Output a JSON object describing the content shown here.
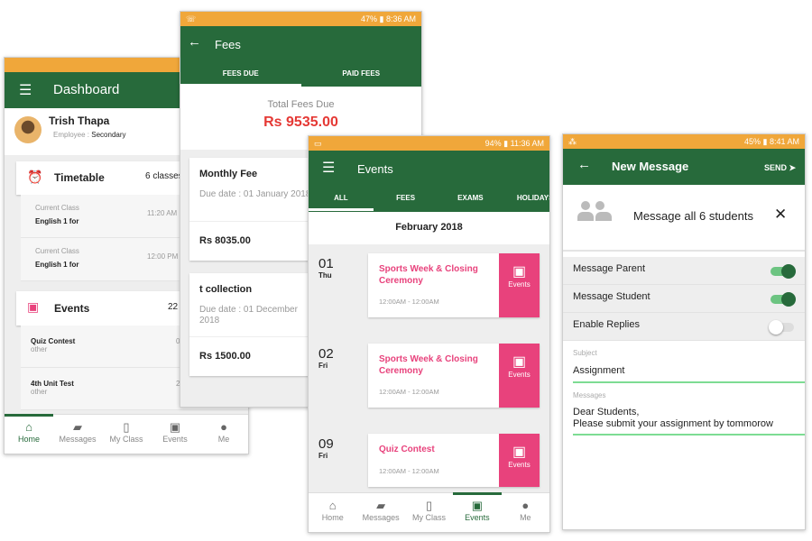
{
  "dashboard": {
    "title": "Dashboard",
    "user_name": "Trish Thapa",
    "employee_label": "Employee :",
    "employee_value": "Secondary",
    "timetable": {
      "label": "Timetable",
      "count": "6 classes",
      "rows": [
        {
          "label": "Current Class",
          "class": "English 1 for",
          "time": "11:20 AM"
        },
        {
          "label": "Current Class",
          "class": "English 1 for",
          "time": "12:00 PM"
        }
      ]
    },
    "events": {
      "label": "Events",
      "count": "22",
      "rows": [
        {
          "name": "Quiz Contest",
          "type": "other",
          "date": "0"
        },
        {
          "name": "4th Unit Test",
          "type": "other",
          "date": "2"
        }
      ]
    }
  },
  "nav": [
    {
      "label": "Home",
      "icon": "home-icon",
      "glyph": "⌂"
    },
    {
      "label": "Messages",
      "icon": "messages-icon",
      "glyph": "▰"
    },
    {
      "label": "My Class",
      "icon": "book-icon",
      "glyph": "▯"
    },
    {
      "label": "Events",
      "icon": "calendar-icon",
      "glyph": "▣"
    },
    {
      "label": "Me",
      "icon": "person-icon",
      "glyph": "●"
    }
  ],
  "fees": {
    "status_time": "47% ▮ 8:36 AM",
    "title": "Fees",
    "tabs": [
      "FEES DUE",
      "PAID FEES"
    ],
    "total_label": "Total Fees Due",
    "total_value": "Rs 9535.00",
    "items": [
      {
        "name": "Monthly Fee",
        "due": "Due date : 01 January 2018",
        "amount": "Rs 8035.00"
      },
      {
        "name": "t collection",
        "due": "Due date : 01 December 2018",
        "amount": "Rs 1500.00"
      }
    ]
  },
  "events": {
    "status_time": "94% ▮ 11:36 AM",
    "title": "Events",
    "tabs": [
      "ALL",
      "FEES",
      "EXAMS",
      "HOLIDAYS"
    ],
    "month": "February 2018",
    "badge": "Events",
    "items": [
      {
        "day": "01",
        "weekday": "Thu",
        "title": "Sports Week & Closing Ceremony",
        "time": "12:00AM - 12:00AM"
      },
      {
        "day": "02",
        "weekday": "Fri",
        "title": "Sports Week & Closing Ceremony",
        "time": "12:00AM - 12:00AM"
      },
      {
        "day": "09",
        "weekday": "Fri",
        "title": "Quiz Contest",
        "time": "12:00AM - 12:00AM"
      }
    ]
  },
  "message": {
    "status_time": "45% ▮ 8:41 AM",
    "title": "New Message",
    "send": "SEND ➤",
    "recipient": "Message all 6 students",
    "toggles": [
      {
        "label": "Message Parent",
        "on": true
      },
      {
        "label": "Message Student",
        "on": true
      },
      {
        "label": "Enable Replies",
        "on": false
      }
    ],
    "subject_label": "Subject",
    "subject_value": "Assignment",
    "messages_label": "Messages",
    "messages_value": "Dear Students,\nPlease submit your assignment by tommorow"
  },
  "colors": {
    "primary": "#276a3b",
    "status_bar": "#f0a73a",
    "accent_red": "#e53935",
    "pink": "#e8427c"
  }
}
